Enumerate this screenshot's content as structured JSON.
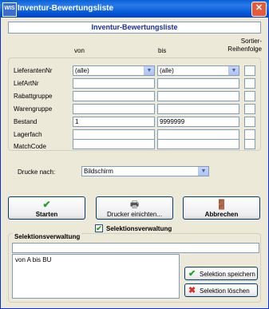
{
  "window": {
    "title": "Inventur-Bewertungsliste",
    "app_icon_text": "WIS"
  },
  "banner": "Inventur-Bewertungsliste",
  "columns": {
    "von": "von",
    "bis": "bis",
    "sortier": "Sortier-\nReihenfolge"
  },
  "rows": [
    {
      "label": "LieferantenNr",
      "von": "(alle)",
      "bis": "(alle)"
    },
    {
      "label": "LiefArtNr",
      "von": "",
      "bis": ""
    },
    {
      "label": "Rabattgruppe",
      "von": "",
      "bis": ""
    },
    {
      "label": "Warengruppe",
      "von": "",
      "bis": ""
    },
    {
      "label": "Bestand",
      "von": "1",
      "bis": "9999999"
    },
    {
      "label": "Lagerfach",
      "von": "",
      "bis": ""
    },
    {
      "label": "MatchCode",
      "von": "",
      "bis": ""
    }
  ],
  "drucke": {
    "label": "Drucke nach:",
    "value": "Bildschirm"
  },
  "buttons": {
    "starten": "Starten",
    "drucker": "Drucker einichten...",
    "abbrechen": "Abbrechen"
  },
  "selektion_checkbox": "Selektionsverwaltung",
  "selektion_group": {
    "title": "Selektionsverwaltung",
    "name_value": "",
    "list_items": [
      "von A bis BU"
    ],
    "save": "Selektion speichern",
    "delete": "Selektion löschen"
  },
  "colors": {
    "title_blue": "#0a5fd6",
    "banner_text": "#1a2ea0",
    "check_green": "#21a121",
    "delete_red": "#d9302a"
  }
}
